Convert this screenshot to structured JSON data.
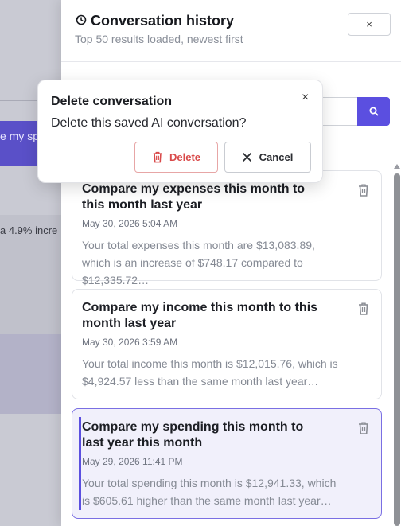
{
  "background": {
    "chip_text": "e my spe",
    "panel_text": "a 4.9% incre"
  },
  "drawer": {
    "title": "Conversation history",
    "subtitle": "Top 50 results loaded, newest first",
    "close_label": "×"
  },
  "dialog": {
    "title": "Delete conversation",
    "message": "Delete this saved AI conversation?",
    "close_label": "×",
    "delete_label": "Delete",
    "cancel_label": "Cancel"
  },
  "conversations": [
    {
      "title": "Compare my expenses this month to this month last year",
      "date": "May 30, 2026 5:04 AM",
      "preview": "Your total expenses this month are $13,083.89, which is an increase of $748.17 compared to $12,335.72…"
    },
    {
      "title": "Compare my income this month to this month last year",
      "date": "May 30, 2026 3:59 AM",
      "preview": "Your total income this month is $12,015.76, which is $4,924.57 less than the same month last year…"
    },
    {
      "title": "Compare my spending this month to last year this month",
      "date": "May 29, 2026 11:41 PM",
      "preview": "Your total spending this month is $12,941.33, which is $605.61 higher than the same month last year…"
    }
  ],
  "colors": {
    "accent": "#5b4fe0",
    "danger": "#d94a4a"
  }
}
